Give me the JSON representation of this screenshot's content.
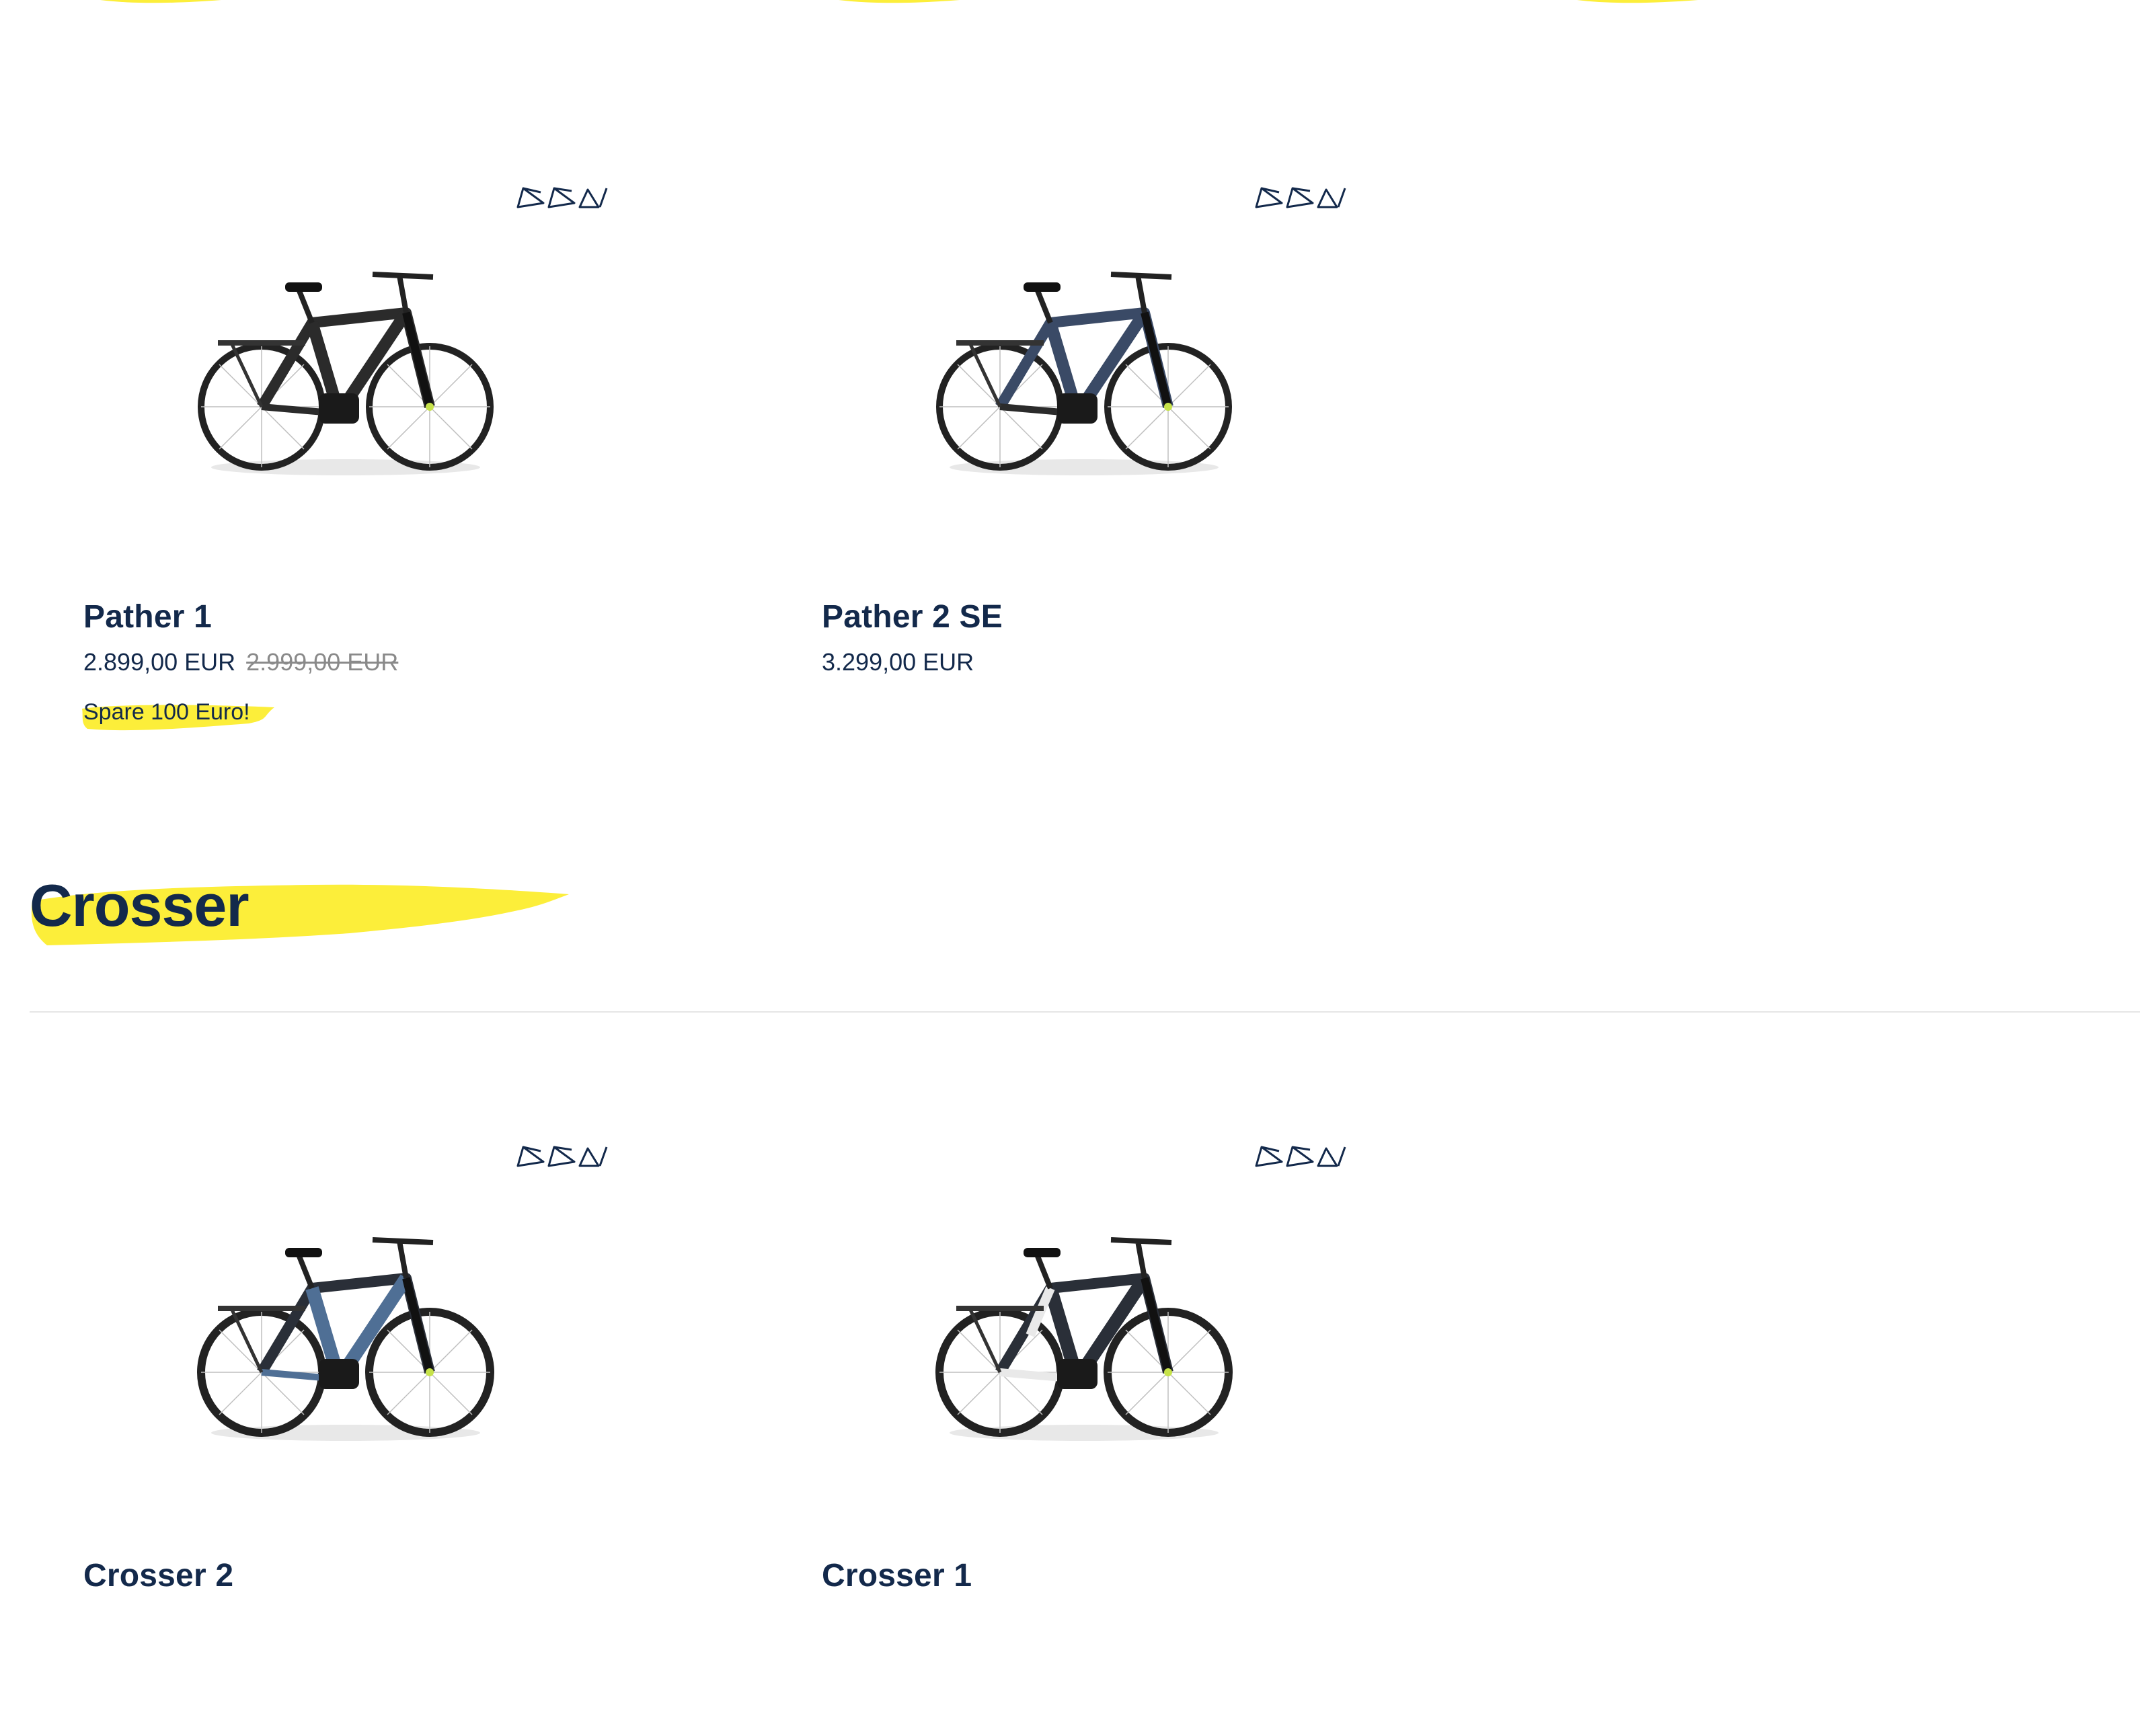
{
  "colors": {
    "navy": "#13294b",
    "highlight_yellow": "#fcee3a",
    "old_price_gray": "#8a8a8a",
    "divider": "#e6e6e6"
  },
  "icons": {
    "frame_types": "bike-frame-type-icons",
    "highlight": "yellow-brush-stroke"
  },
  "sections": {
    "pather": {
      "products": [
        {
          "name": "Pather 1",
          "price": "2.899,00 EUR",
          "old_price": "2.999,00 EUR",
          "promo": "Spare 100 Euro!",
          "bike_accent": "#2b2b2b"
        },
        {
          "name": "Pather 2 SE",
          "price": "3.299,00 EUR",
          "bike_accent": "#3a4a66"
        }
      ]
    },
    "crosser": {
      "title": "Crosser",
      "products": [
        {
          "name": "Crosser 2",
          "bike_accent": "#4f6f95"
        },
        {
          "name": "Crosser 1",
          "bike_accent": "#e9e9e9"
        }
      ]
    }
  }
}
